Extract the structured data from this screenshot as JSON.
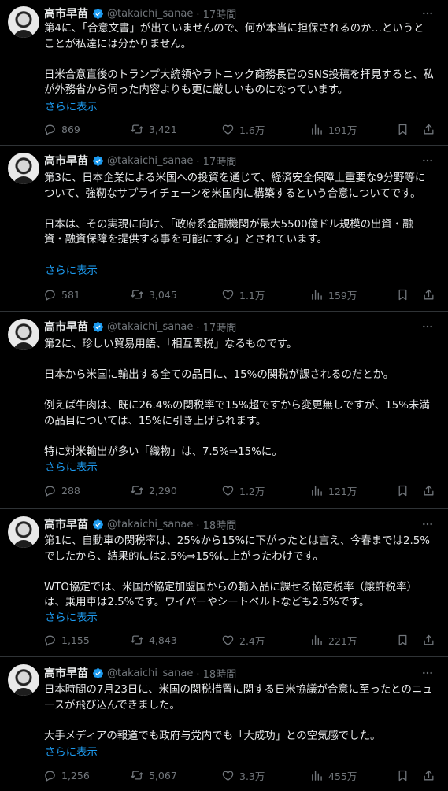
{
  "tweets": [
    {
      "author_name": "高市早苗",
      "author_handle": "@takaichi_sanae",
      "time": "· 17時間",
      "paragraphs": [
        "第4に、「合意文書」が出ていませんので、何が本当に担保されるのか…というとことが私達には分かりません。",
        "日米合意直後のトランプ大統領やラトニック商務長官のSNS投稿を拝見すると、私が外務省から伺った内容よりも更に厳しいものになっています。"
      ],
      "show_more": "さらに表示",
      "replies": "869",
      "retweets": "3,421",
      "likes": "1.6万",
      "views": "191万"
    },
    {
      "author_name": "高市早苗",
      "author_handle": "@takaichi_sanae",
      "time": "· 17時間",
      "paragraphs": [
        "第3に、日本企業による米国への投資を通じて、経済安全保障上重要な9分野等について、強靭なサプライチェーンを米国内に構築するという合意についてです。",
        "日本は、その実現に向け、「政府系金融機関が最大5500億ドル規模の出資・融資・融資保障を提供する事を可能にする」とされています。"
      ],
      "show_more": "さらに表示",
      "replies": "581",
      "retweets": "3,045",
      "likes": "1.1万",
      "views": "159万"
    },
    {
      "author_name": "高市早苗",
      "author_handle": "@takaichi_sanae",
      "time": "· 17時間",
      "paragraphs": [
        "第2に、珍しい貿易用語、「相互関税」なるものです。",
        "日本から米国に輸出する全ての品目に、15%の関税が課されるのだとか。",
        "例えば牛肉は、既に26.4%の関税率で15%超ですから変更無しですが、15%未満の品目については、15%に引き上げられます。",
        "特に対米輸出が多い「織物」は、7.5%⇒15%に。"
      ],
      "show_more": "さらに表示",
      "replies": "288",
      "retweets": "2,290",
      "likes": "1.2万",
      "views": "121万"
    },
    {
      "author_name": "高市早苗",
      "author_handle": "@takaichi_sanae",
      "time": "· 18時間",
      "paragraphs": [
        "第1に、自動車の関税率は、25%から15%に下がったとは言え、今春までは2.5%でしたから、結果的には2.5%⇒15%に上がったわけです。",
        "WTO協定では、米国が協定加盟国からの輸入品に課せる協定税率（譲許税率）は、乗用車は2.5%です。ワイパーやシートベルトなども2.5%です。"
      ],
      "show_more": "さらに表示",
      "replies": "1,155",
      "retweets": "4,843",
      "likes": "2.4万",
      "views": "221万"
    },
    {
      "author_name": "高市早苗",
      "author_handle": "@takaichi_sanae",
      "time": "· 18時間",
      "paragraphs": [
        "日本時間の7月23日に、米国の関税措置に関する日米協議が合意に至ったとのニュースが飛び込んできました。",
        "大手メディアの報道でも政府与党内でも「大成功」との空気感でした。"
      ],
      "show_more": "さらに表示",
      "replies": "1,256",
      "retweets": "5,067",
      "likes": "3.3万",
      "views": "455万"
    }
  ],
  "icons": {
    "verified": "verified-badge-icon",
    "more": "more-dots-icon",
    "reply": "reply-bubble-icon",
    "retweet": "retweet-icon",
    "like": "heart-icon",
    "views": "views-bar-chart-icon",
    "bookmark": "bookmark-icon",
    "share": "share-icon"
  },
  "colors": {
    "background": "#000000",
    "text": "#e7e9ea",
    "muted": "#71767b",
    "link": "#1d9bf0",
    "verified": "#1d9bf0",
    "separator": "#2f3336"
  }
}
